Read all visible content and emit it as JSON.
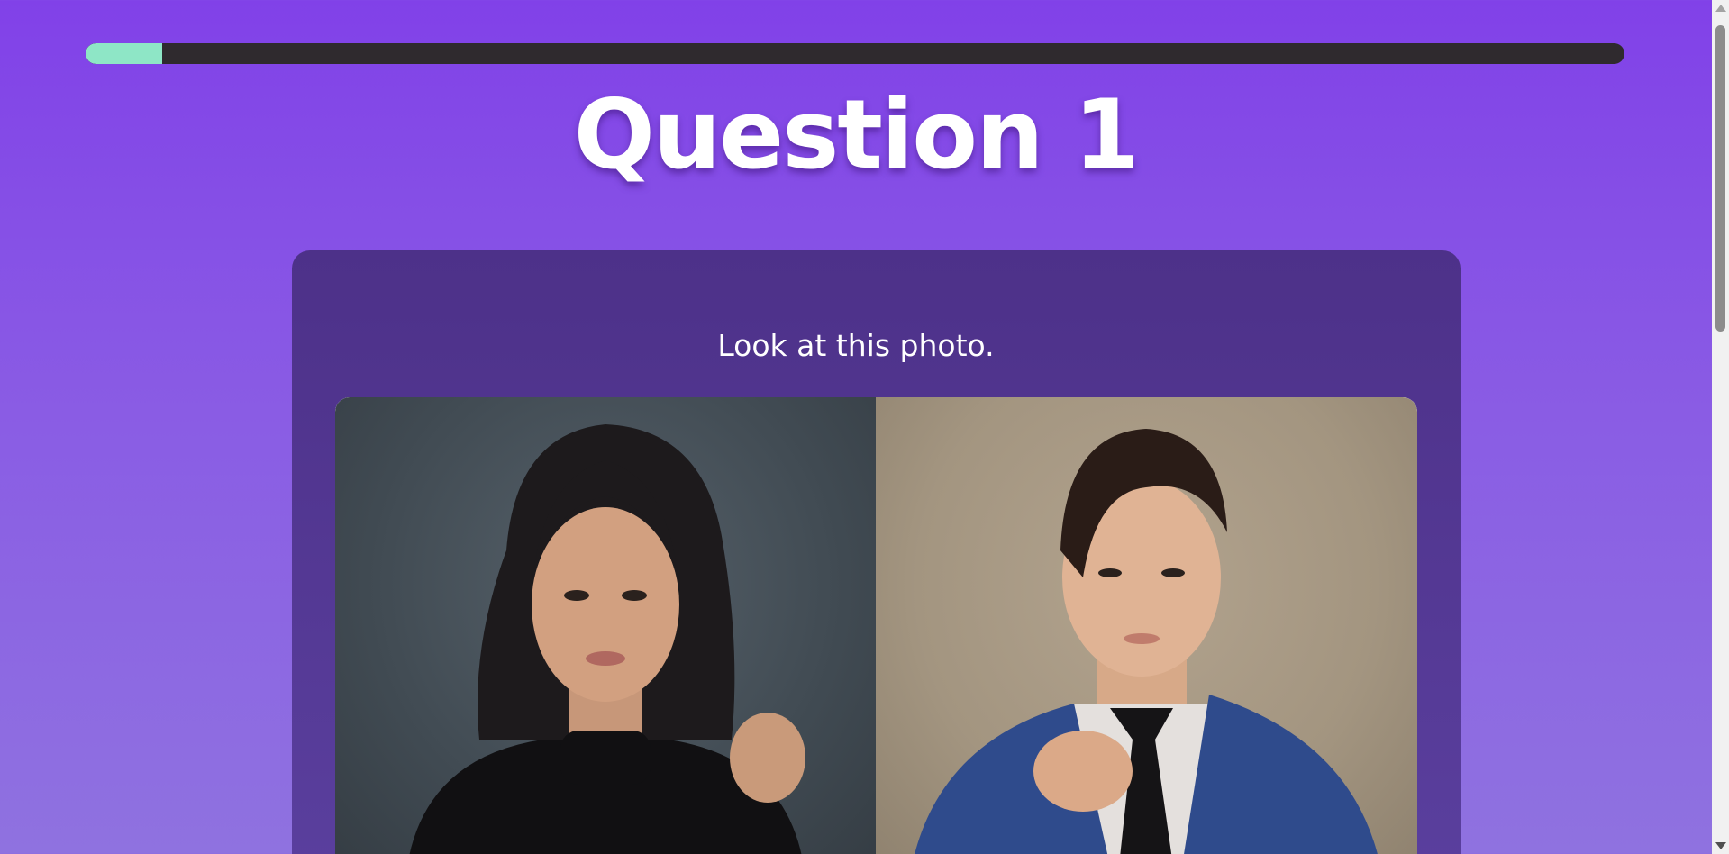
{
  "quiz": {
    "progress_fraction": 0.05,
    "title": "Question 1",
    "prompt": "Look at this photo."
  },
  "colors": {
    "background": "#8141e8",
    "progress_fill": "#8ee6c6",
    "progress_track": "#2f2a2e",
    "card": "#4d3189"
  },
  "photo": {
    "left_subject": "woman-in-black-turtleneck",
    "right_subject": "person-in-blue-suit"
  }
}
